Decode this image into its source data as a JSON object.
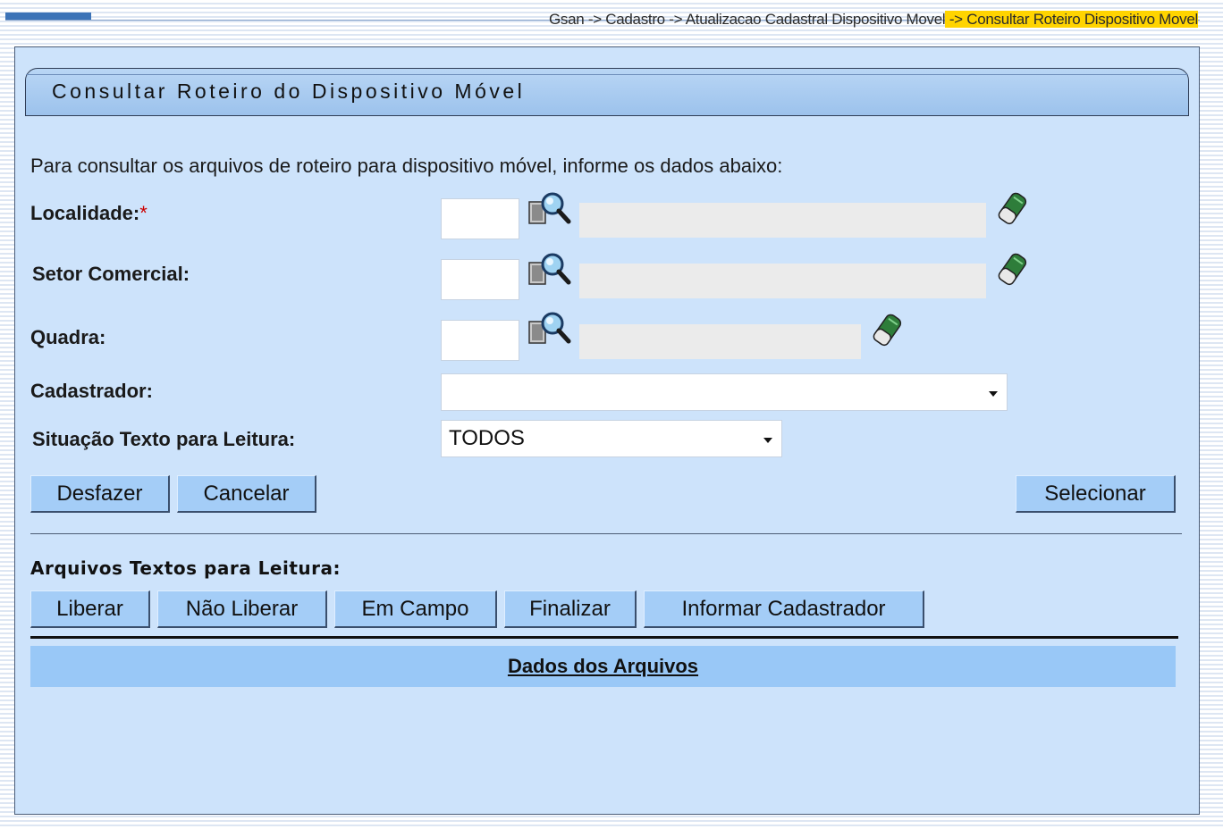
{
  "breadcrumb": {
    "path": "Gsan -> Cadastro -> Atualizacao Cadastral Dispositivo Movel",
    "current": " -> Consultar Roteiro Dispositivo Movel"
  },
  "page_title": "Consultar Roteiro do Dispositivo Móvel",
  "intro_text": "Para consultar os arquivos de roteiro para dispositivo móvel, informe os dados abaixo:",
  "form": {
    "localidade": {
      "label": "Localidade:",
      "required_mark": "*",
      "code": "",
      "description": ""
    },
    "setor_comercial": {
      "label": "Setor Comercial:",
      "code": "",
      "description": ""
    },
    "quadra": {
      "label": "Quadra:",
      "code": "",
      "description": ""
    },
    "cadastrador": {
      "label": "Cadastrador:",
      "selected": ""
    },
    "situacao": {
      "label": "Situação Texto para Leitura:",
      "selected": "TODOS"
    }
  },
  "buttons": {
    "desfazer": "Desfazer",
    "cancelar": "Cancelar",
    "selecionar": "Selecionar"
  },
  "arquivos": {
    "label": "Arquivos Textos para Leitura:",
    "liberar": "Liberar",
    "nao_liberar": "Não Liberar",
    "em_campo": "Em Campo",
    "finalizar": "Finalizar",
    "informar_cadastrador": "Informar Cadastrador"
  },
  "data_section": {
    "title": "Dados dos Arquivos"
  },
  "icons": {
    "search": "magnifier-search-icon",
    "clear": "eraser-clear-icon"
  },
  "colors": {
    "panel_bg": "#cde3fb",
    "button_bg": "#a4cdf7",
    "header_bg": "#99c8f7",
    "breadcrumb_highlight": "#ffd400",
    "required": "#cc0000"
  }
}
